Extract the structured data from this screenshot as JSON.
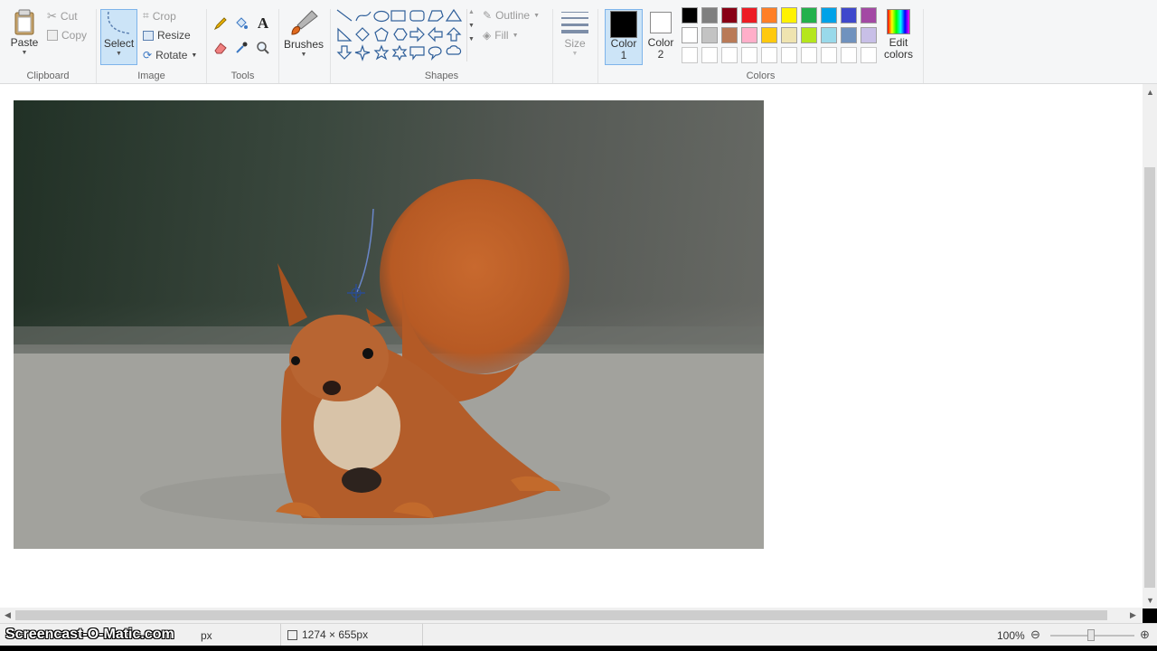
{
  "clipboard": {
    "paste_label": "Paste",
    "cut_label": "Cut",
    "copy_label": "Copy",
    "group_label": "Clipboard"
  },
  "image": {
    "select_label": "Select",
    "crop_label": "Crop",
    "resize_label": "Resize",
    "rotate_label": "Rotate",
    "group_label": "Image"
  },
  "tools": {
    "group_label": "Tools"
  },
  "brushes": {
    "label": "Brushes"
  },
  "shapes": {
    "outline_label": "Outline",
    "fill_label": "Fill",
    "group_label": "Shapes"
  },
  "size": {
    "label": "Size"
  },
  "colors": {
    "color1_label": "Color",
    "color1_num": "1",
    "color2_label": "Color",
    "color2_num": "2",
    "edit_label": "Edit",
    "edit_label2": "colors",
    "group_label": "Colors",
    "color1_value": "#000000",
    "color2_value": "#ffffff",
    "row1": [
      "#000000",
      "#7f7f7f",
      "#880015",
      "#ed1c24",
      "#ff7f27",
      "#fff200",
      "#22b14c",
      "#00a2e8",
      "#3f48cc",
      "#a349a4"
    ],
    "row2": [
      "#ffffff",
      "#c3c3c3",
      "#b97a57",
      "#ffaec9",
      "#ffc90e",
      "#efe4b0",
      "#b5e61d",
      "#99d9ea",
      "#7092be",
      "#c8bfe7"
    ],
    "row3": [
      "#ffffff",
      "#ffffff",
      "#ffffff",
      "#ffffff",
      "#ffffff",
      "#ffffff",
      "#ffffff",
      "#ffffff",
      "#ffffff",
      "#ffffff"
    ]
  },
  "status": {
    "position": "1274 × 655px",
    "zoom": "100%",
    "watermark": "Screencast-O-Matic.com",
    "partial_size": "px"
  }
}
